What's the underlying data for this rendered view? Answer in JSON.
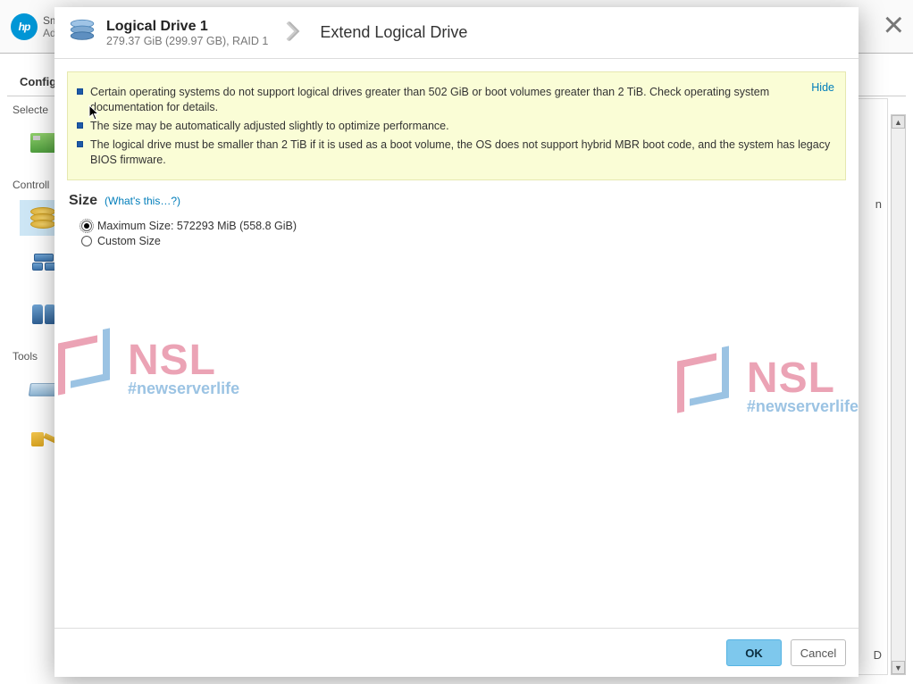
{
  "app": {
    "title_line1": "Sm",
    "title_line2": "Ad"
  },
  "tabs": {
    "active": "Configu"
  },
  "sidebar": {
    "sections": {
      "selected": "Selecte",
      "devices": "Controll",
      "tools": "Tools"
    }
  },
  "main_bg": {
    "snip1": "n",
    "snip2": "D"
  },
  "modal": {
    "drive_title": "Logical Drive 1",
    "drive_sub": "279.37 GiB (299.97 GB), RAID 1",
    "action_title": "Extend Logical Drive",
    "info": {
      "hide": "Hide",
      "items": [
        "Certain operating systems do not support logical drives greater than 502 GiB or boot volumes greater than 2 TiB. Check operating system documentation for details.",
        "The size may be automatically adjusted slightly to optimize performance.",
        "The logical drive must be smaller than 2 TiB if it is used as a boot volume, the OS does not support hybrid MBR boot code, and the system has legacy BIOS firmware."
      ]
    },
    "size": {
      "label": "Size",
      "whats_this": "(What's this…?)",
      "max_label": "Maximum Size: 572293 MiB (558.8 GiB)",
      "custom_label": "Custom Size"
    },
    "buttons": {
      "ok": "OK",
      "cancel": "Cancel"
    }
  },
  "watermark": {
    "big": "NSL",
    "small": "#newserverlife"
  }
}
